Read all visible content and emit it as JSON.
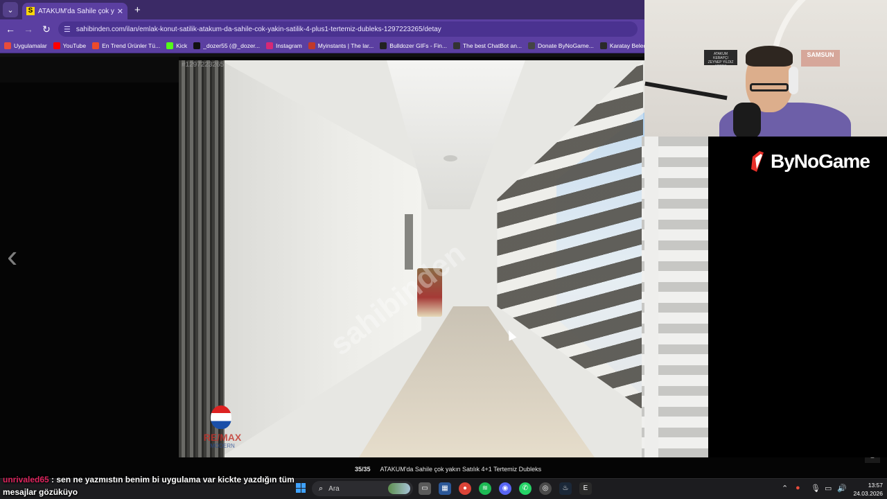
{
  "browser": {
    "tab_title": "ATAKUM'da Sahile çok yakın Sa",
    "tab_close_icon": "close-icon",
    "new_tab_icon": "plus-icon",
    "url": "sahibinden.com/ilan/emlak-konut-satilik-atakum-da-sahile-cok-yakin-satilik-4-plus1-tertemiz-dubleks-1297223265/detay",
    "bookmarks": [
      {
        "label": "Uygulamalar",
        "icon": "apps-grid-icon",
        "color": "#e74c3c"
      },
      {
        "label": "YouTube",
        "icon": "youtube-icon",
        "color": "#ff0000"
      },
      {
        "label": "En Trend Ürünler Tü...",
        "icon": "trendyol-icon",
        "color": "#ee4b2b"
      },
      {
        "label": "Kick",
        "icon": "kick-icon",
        "color": "#53fc18"
      },
      {
        "label": "_dozer55 (@_dozer...",
        "icon": "tiktok-icon",
        "color": "#111111"
      },
      {
        "label": "Instagram",
        "icon": "instagram-icon",
        "color": "#d62976"
      },
      {
        "label": "Myinstants | The lar...",
        "icon": "myinstants-icon",
        "color": "#c0392b"
      },
      {
        "label": "Bulldozer GIFs - Fin...",
        "icon": "giphy-icon",
        "color": "#222222"
      },
      {
        "label": "The best ChatBot an...",
        "icon": "chatbot-icon",
        "color": "#333333"
      },
      {
        "label": "Donate ByNoGame...",
        "icon": "bynogame-icon",
        "color": "#444444"
      },
      {
        "label": "Karatay Belediyesp",
        "icon": "check-icon",
        "color": "#2a2a2a"
      }
    ]
  },
  "viewer": {
    "photo_id": "#1297223265",
    "counter": "35/35",
    "caption": "ATAKUM'da Sahile çok yakın Satılık 4+1 Tertemiz Dubleks",
    "watermark": "sahibinden",
    "remax_text": "RE/MAX",
    "remax_sub": "MODERN",
    "scroll_top_icon": "arrow-up-icon"
  },
  "webcam": {
    "sign_left": "ATAKUM KEBAPÇI ZEYNEP YILDIZ ADRES",
    "sign_right": "SAMSUN"
  },
  "brand": {
    "name": "ByNoGame"
  },
  "chat": {
    "username": "unrivaled65",
    "message": " : sen ne yazmıstın benim bi uygulama var kickte yazdığın tüm mesajlar gözüküyo"
  },
  "taskbar": {
    "search_placeholder": "Ara",
    "time": "13:57",
    "date": "24.03.2026"
  }
}
